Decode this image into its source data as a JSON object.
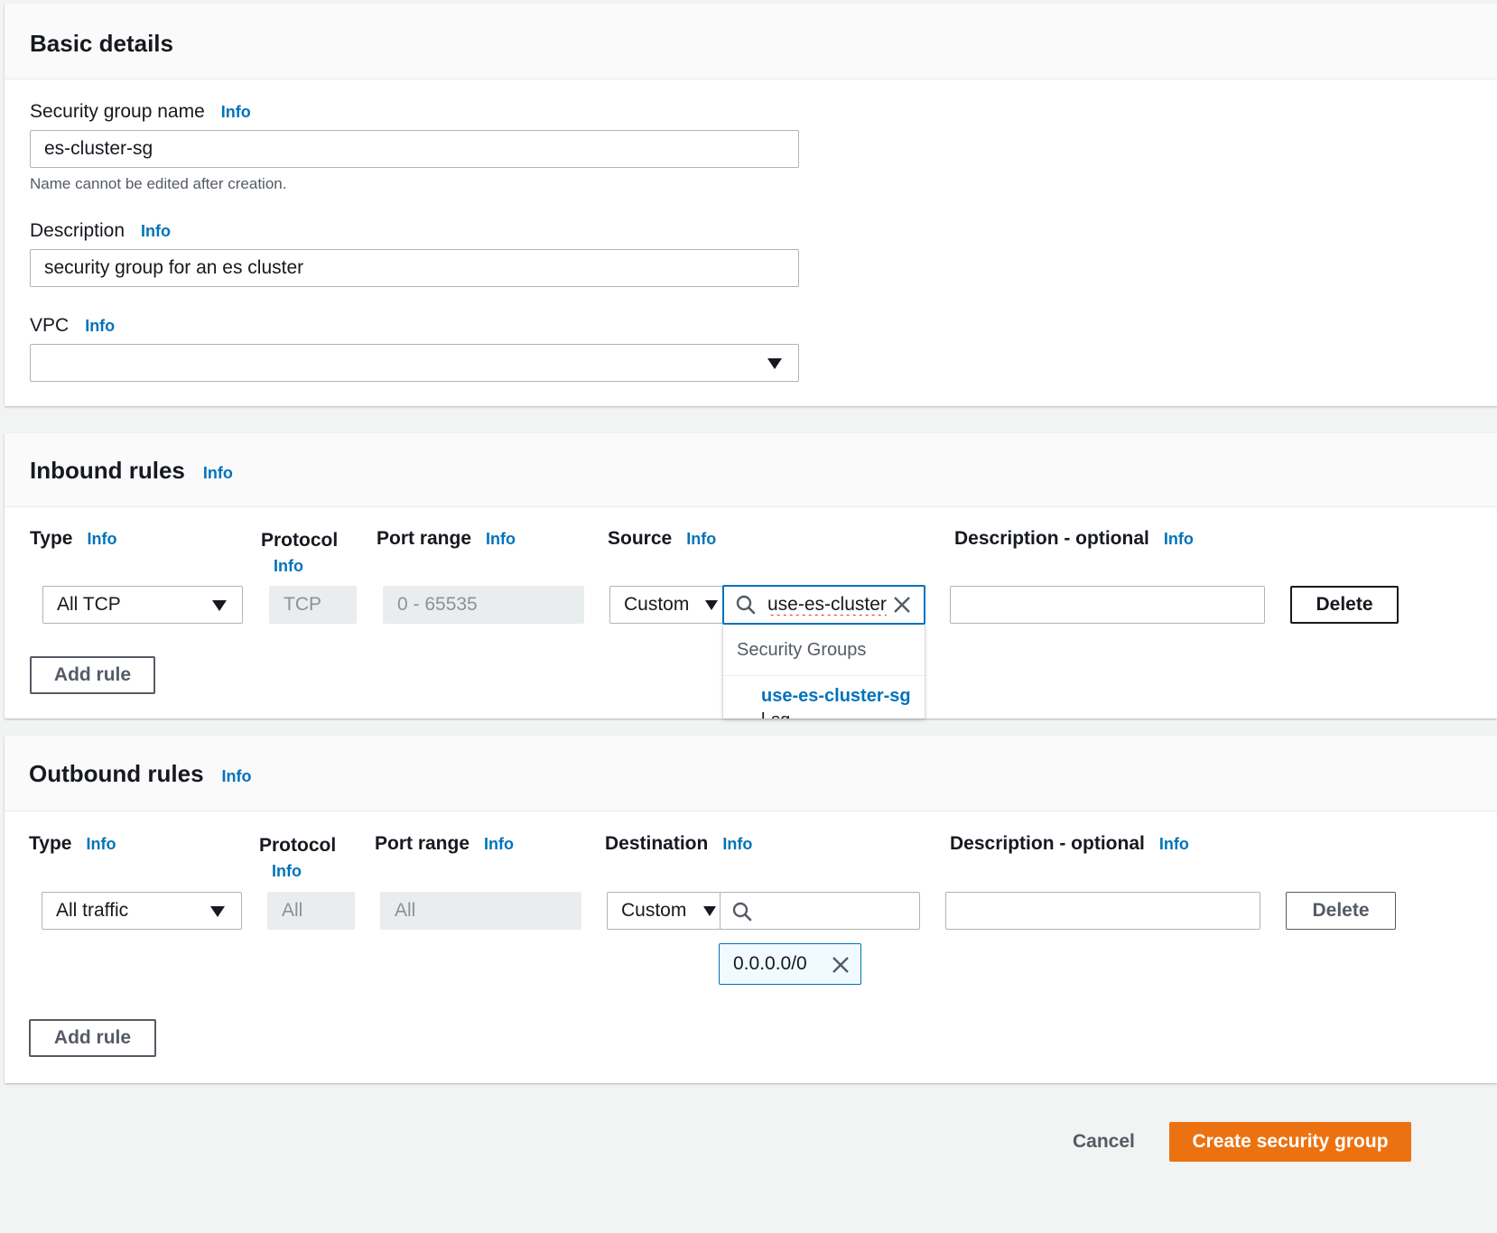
{
  "basic": {
    "title": "Basic details",
    "name_label": "Security group name",
    "name_info": "Info",
    "name_value": "es-cluster-sg",
    "name_hint": "Name cannot be edited after creation.",
    "desc_label": "Description",
    "desc_info": "Info",
    "desc_value": "security group for an es cluster",
    "vpc_label": "VPC",
    "vpc_info": "Info",
    "vpc_value": ""
  },
  "inbound": {
    "title": "Inbound rules",
    "info": "Info",
    "col_type": "Type",
    "col_type_info": "Info",
    "col_protocol": "Protocol",
    "col_protocol_info": "Info",
    "col_port": "Port range",
    "col_port_info": "Info",
    "col_source": "Source",
    "col_source_info": "Info",
    "col_desc": "Description - optional",
    "col_desc_info": "Info",
    "type_value": "All TCP",
    "protocol_value": "TCP",
    "port_value": "0 - 65535",
    "source_type": "Custom",
    "search_value": "use-es-cluster",
    "dropdown_header": "Security Groups",
    "dropdown_option": "use-es-cluster-sg",
    "dropdown_option_sub": "l-sg",
    "desc_value": "",
    "delete_label": "Delete",
    "add_rule_label": "Add rule"
  },
  "outbound": {
    "title": "Outbound rules",
    "info": "Info",
    "col_type": "Type",
    "col_type_info": "Info",
    "col_protocol": "Protocol",
    "col_protocol_info": "Info",
    "col_port": "Port range",
    "col_port_info": "Info",
    "col_dest": "Destination",
    "col_dest_info": "Info",
    "col_desc": "Description - optional",
    "col_desc_info": "Info",
    "type_value": "All traffic",
    "protocol_value": "All",
    "port_value": "All",
    "dest_type": "Custom",
    "search_value": "",
    "token_value": "0.0.0.0/0",
    "desc_value": "",
    "delete_label": "Delete",
    "add_rule_label": "Add rule"
  },
  "footer": {
    "cancel_label": "Cancel",
    "create_label": "Create security group"
  },
  "colors": {
    "accent": "#0073bb",
    "primary_button": "#ec7211"
  }
}
